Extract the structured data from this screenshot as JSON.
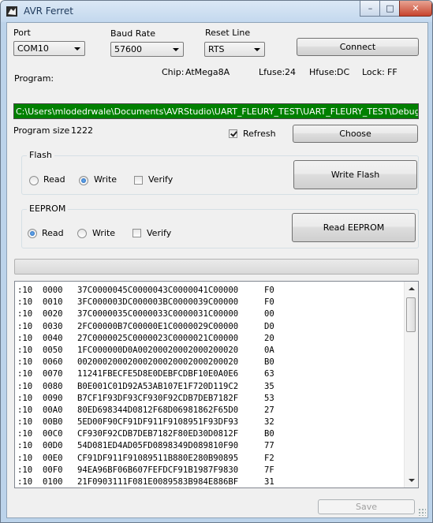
{
  "window": {
    "title": "AVR Ferret"
  },
  "connection": {
    "port_label": "Port",
    "port_value": "COM10",
    "baud_label": "Baud Rate",
    "baud_value": "57600",
    "reset_label": "Reset Line",
    "reset_value": "RTS",
    "connect_label": "Connect"
  },
  "chip": {
    "program_label": "Program:",
    "chip_label": "Chip:",
    "chip_value": "AtMega8A",
    "lfuse_label": "Lfuse:",
    "lfuse_value": "24",
    "hfuse_label": "Hfuse:",
    "hfuse_value": "DC",
    "lock_label": "Lock:",
    "lock_value": "FF"
  },
  "program": {
    "path": "C:\\Users\\mlodedrwale\\Documents\\AVRStudio\\UART_FLEURY_TEST\\UART_FLEURY_TEST\\Debug\\UART_FLEURY_TEST.hex",
    "size_label": "Program size",
    "size_value": "1222",
    "refresh_label": "Refresh",
    "refresh_checked": true,
    "choose_label": "Choose"
  },
  "flash": {
    "legend": "Flash",
    "read_label": "Read",
    "write_label": "Write",
    "verify_label": "Verify",
    "selected": "Write",
    "verify_checked": false,
    "action_label": "Write Flash"
  },
  "eeprom": {
    "legend": "EEPROM",
    "read_label": "Read",
    "write_label": "Write",
    "verify_label": "Verify",
    "selected": "Read",
    "verify_checked": false,
    "action_label": "Read EEPROM"
  },
  "progress": {
    "value": 0
  },
  "hex_lines": [
    [
      ":10",
      "0000",
      "37C0000045C0000043C0000041C00000",
      "F0"
    ],
    [
      ":10",
      "0010",
      "3FC000003DC000003BC0000039C00000",
      "F0"
    ],
    [
      ":10",
      "0020",
      "37C0000035C0000033C0000031C00000",
      "00"
    ],
    [
      ":10",
      "0030",
      "2FC00000B7C00000E1C0000029C00000",
      "D0"
    ],
    [
      ":10",
      "0040",
      "27C0000025C0000023C0000021C00000",
      "20"
    ],
    [
      ":10",
      "0050",
      "1FC000000D0A00200020002000200020",
      "0A"
    ],
    [
      ":10",
      "0060",
      "00200020002000200020002000200020",
      "B0"
    ],
    [
      ":10",
      "0070",
      "11241FBECFE5D8E0DEBFCDBF10E0A0E6",
      "63"
    ],
    [
      ":10",
      "0080",
      "B0E001C01D92A53AB107E1F720D119C2",
      "35"
    ],
    [
      ":10",
      "0090",
      "B7CF1F93DF93CF930F92CDB7DEB7182F",
      "53"
    ],
    [
      ":10",
      "00A0",
      "80ED698344D0812F68D06981862F65D0",
      "27"
    ],
    [
      ":10",
      "00B0",
      "5ED00F90CF91DF911F9108951F93DF93",
      "32"
    ],
    [
      ":10",
      "00C0",
      "CF930F92CDB7DEB7182F80ED30D0812F",
      "B0"
    ],
    [
      ":10",
      "00D0",
      "54D081ED4AD05FD0898349D089810F90",
      "77"
    ],
    [
      ":10",
      "00E0",
      "CF91DF911F91089511B880E280B90895",
      "F2"
    ],
    [
      ":10",
      "00F0",
      "94EA96BF06B607FEFDCF91B1987F9830",
      "7F"
    ],
    [
      ":10",
      "0100",
      "21F0903111F081E0089583B984E886BF",
      "31"
    ]
  ],
  "footer": {
    "save_label": "Save"
  }
}
